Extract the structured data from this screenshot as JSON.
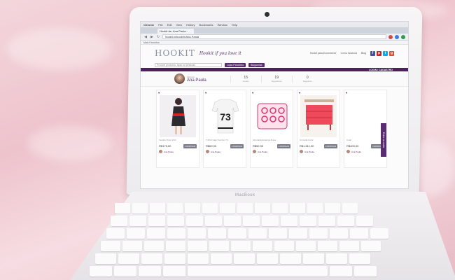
{
  "browser": {
    "app_menu": [
      "Chrome",
      "File",
      "Edit",
      "View",
      "History",
      "Bookmarks",
      "Window",
      "Help"
    ],
    "tab_title": "Hookit de: Ana Paula ◦",
    "url": "hookit.in/hooker/Ana-Paula",
    "bookmarks_text": "Mais Favoritos"
  },
  "site": {
    "logo": "HOOKIT",
    "tagline": "Hookit if you love it",
    "header_links": [
      "Hookit para Ecommerce",
      "Como funciona",
      "Blog"
    ],
    "search_placeholder": "Procure produtos, lojas ou pessoas",
    "pill_stores": "Lojas Parceiras",
    "pill_bloggers": "Blogueiras",
    "login_label": "LOGIN / CADASTRO",
    "social_colors": [
      "#3b5998",
      "#cb2027",
      "#00aced",
      "#dd4b39"
    ]
  },
  "profile": {
    "sub": "Shopper",
    "name": "Ana Paula",
    "stats": [
      {
        "n": "15",
        "l": "Hooks"
      },
      {
        "n": "19",
        "l": "Seguidores"
      },
      {
        "n": "0",
        "l": "Seguindo"
      }
    ]
  },
  "cards": [
    {
      "name": "Vestido Preto Vinil",
      "price": "R$175,00",
      "buy": "COMPRAR",
      "owner": "Ana Paula"
    },
    {
      "name": "T-Shirt Hapi Number 73",
      "price": "R$69,90",
      "buy": "COMPRAR",
      "owner": "Ana Paula"
    },
    {
      "name": "Almofada Estampa Rosa",
      "price": "R$52,90",
      "buy": "COMPRAR",
      "owner": "Ana Paula"
    },
    {
      "name": "Cômoda Coral",
      "price": "R$1.511,00",
      "buy": "COMPRAR",
      "owner": "Ana Paula"
    },
    {
      "name": "Colar",
      "price": "R$400,00",
      "buy": "COMPRAR",
      "owner": "Ana Paula"
    }
  ],
  "side_tab": "Entre na onda",
  "laptop_brand": "MacBook"
}
